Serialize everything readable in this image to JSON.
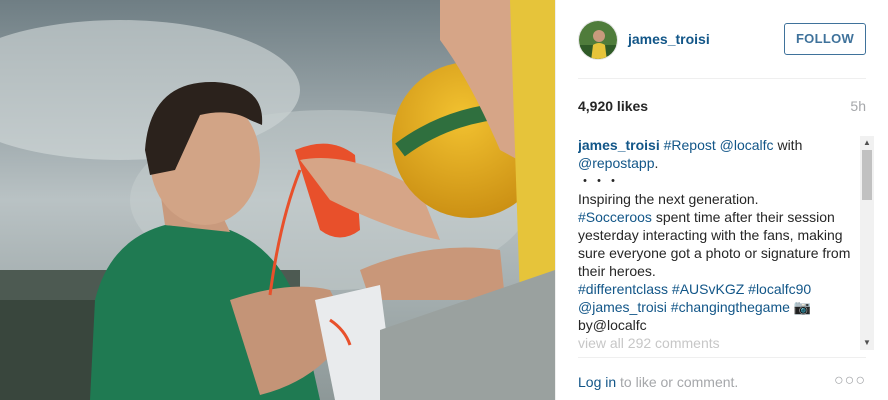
{
  "post": {
    "photo_description_icon": "photo-icon",
    "author": {
      "username": "james_troisi",
      "avatar_icon": "avatar-icon"
    },
    "follow_label": "FOLLOW",
    "likes": "4,920 likes",
    "time_ago": "5h",
    "caption": {
      "username": "james_troisi",
      "line1_tag": "#Repost",
      "line1_mention": "@localfc",
      "line1_with": " with",
      "line2_mention": "@repostapp",
      "line2_end": ".",
      "dots": "・・・",
      "text1": "Inspiring the next generation.",
      "tag_socceroos": "#Socceroos",
      "text2": " spent time after their session yesterday interacting with the fans, making sure everyone got a photo or signature from their heroes.",
      "tag_differentclass": "#differentclass",
      "tag_ausvkgz": "#AUSvKGZ",
      "tag_localfc90": "#localfc90",
      "mention_james": "@james_troisi",
      "tag_changingthegame": "#changingthegame",
      "camera_emoji": "📷",
      "byline": "by@localfc",
      "view_comments": "view all 292 comments"
    },
    "footer": {
      "login_label": "Log in",
      "login_suffix": " to like or comment.",
      "more_label": "○○○"
    },
    "colors": {
      "link": "#125688",
      "follow": "#3f729b",
      "muted": "#a5a7aa"
    }
  }
}
